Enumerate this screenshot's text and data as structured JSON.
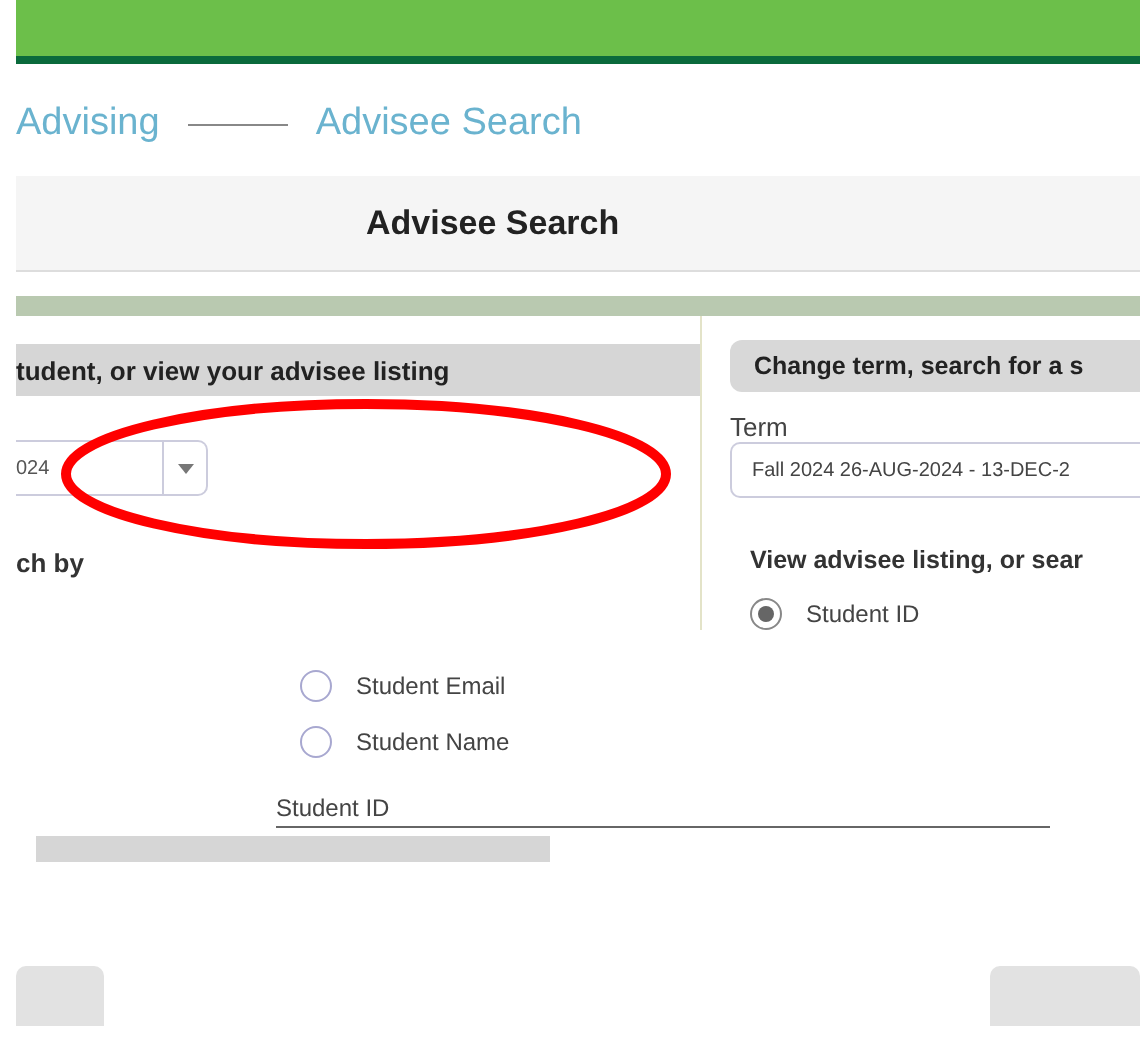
{
  "breadcrumb": [
    "Advising",
    "Advisee Search"
  ],
  "title": "Advisee Search",
  "left_panel": {
    "heading": "tudent, or view your advisee listing",
    "term_select": {
      "value": "024"
    },
    "search_by_label": "ch by"
  },
  "right_panel": {
    "heading": "Change term, search for a s",
    "term_label": "Term",
    "term_select": {
      "value": "Fall 2024 26-AUG-2024 - 13-DEC-2"
    },
    "listing_label": "View advisee listing, or sear",
    "options": [
      {
        "label": "Student ID",
        "selected": true
      }
    ]
  },
  "search_options": [
    {
      "label": "Student Email",
      "selected": false
    },
    {
      "label": "Student Name",
      "selected": false
    }
  ],
  "student_id_field": {
    "label": "Student ID"
  },
  "annotation": {
    "kind": "ellipse"
  }
}
